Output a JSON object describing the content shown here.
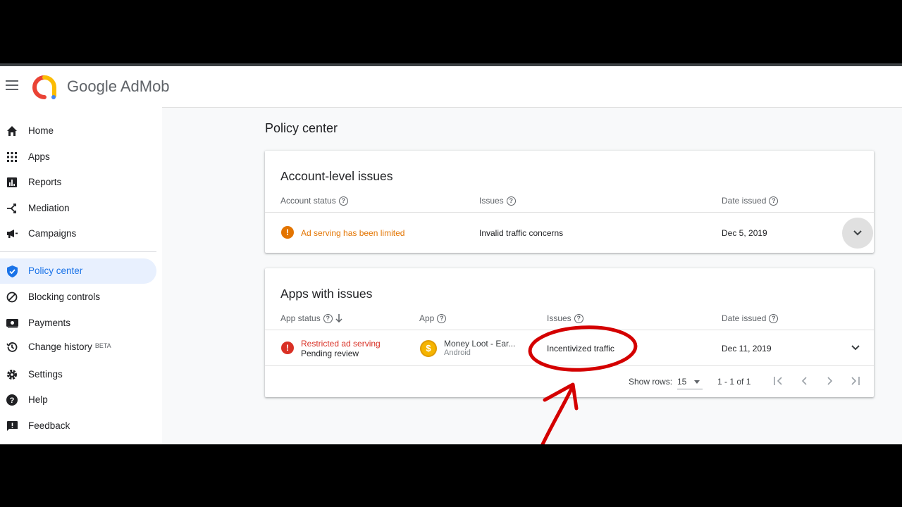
{
  "brand": {
    "name": "Google AdMob"
  },
  "sidebar": {
    "items": [
      {
        "label": "Home",
        "icon": "home-icon"
      },
      {
        "label": "Apps",
        "icon": "apps-grid-icon"
      },
      {
        "label": "Reports",
        "icon": "reports-icon"
      },
      {
        "label": "Mediation",
        "icon": "mediation-icon"
      },
      {
        "label": "Campaigns",
        "icon": "megaphone-icon"
      },
      {
        "label": "Policy center",
        "icon": "shield-check-icon",
        "active": true
      },
      {
        "label": "Blocking controls",
        "icon": "block-icon"
      },
      {
        "label": "Payments",
        "icon": "payments-icon"
      },
      {
        "label": "Change history",
        "badge": "BETA",
        "icon": "history-icon"
      },
      {
        "label": "Settings",
        "icon": "gear-icon"
      },
      {
        "label": "Help",
        "icon": "help-icon"
      },
      {
        "label": "Feedback",
        "icon": "feedback-icon"
      }
    ]
  },
  "main": {
    "title": "Policy center",
    "account_card": {
      "title": "Account-level issues",
      "columns": [
        "Account status",
        "Issues",
        "Date issued"
      ],
      "row": {
        "status": "Ad serving has been limited",
        "issue": "Invalid traffic concerns",
        "date": "Dec 5, 2019"
      }
    },
    "apps_card": {
      "title": "Apps with issues",
      "columns": [
        "App status",
        "App",
        "Issues",
        "Date issued"
      ],
      "row": {
        "status": "Restricted ad serving",
        "substatus": "Pending review",
        "app_name": "Money Loot - Ear...",
        "platform": "Android",
        "app_icon_glyph": "$",
        "issue": "Incentivized traffic",
        "date": "Dec 11, 2019"
      },
      "footer": {
        "show_rows_label": "Show rows:",
        "rows_value": "15",
        "range": "1 - 1 of 1"
      }
    }
  },
  "colors": {
    "accent": "#1a73e8",
    "warning": "#e37400",
    "error": "#d93025",
    "annotation": "#d40000"
  }
}
